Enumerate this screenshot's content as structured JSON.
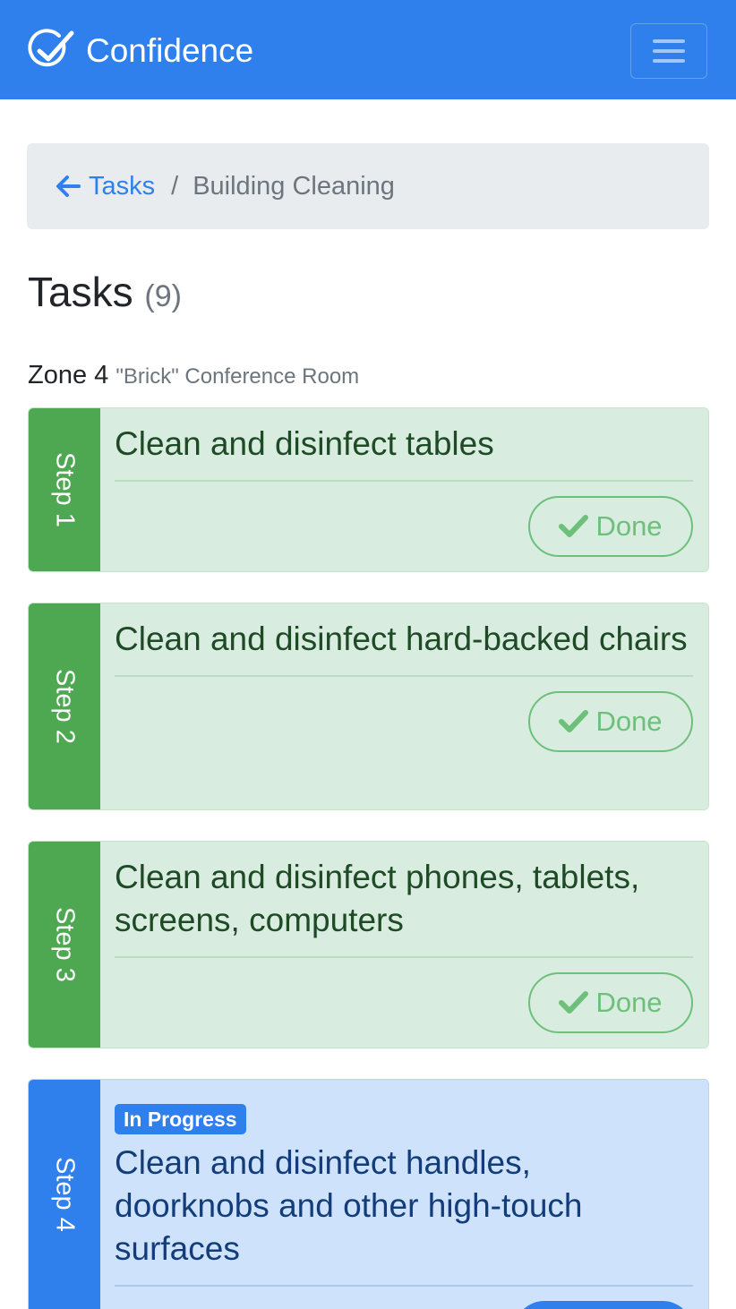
{
  "navbar": {
    "brand": "Confidence",
    "brand_icon": "check-circle-icon",
    "menu_icon": "hamburger-menu-icon",
    "color": "#2f80ed"
  },
  "breadcrumb": {
    "back_icon": "arrow-left-icon",
    "link_label": "Tasks",
    "separator": "/",
    "current": "Building Cleaning"
  },
  "page": {
    "title": "Tasks",
    "count": "(9)"
  },
  "zone": {
    "label": "Zone 4",
    "name": "\"Brick\" Conference Room"
  },
  "tasks": [
    {
      "step": "Step 1",
      "title": "Clean and disinfect tables",
      "status": "done",
      "button_label": "Done",
      "button_icon": "check-icon"
    },
    {
      "step": "Step 2",
      "title": "Clean and disinfect hard-backed chairs",
      "status": "done",
      "button_label": "Done",
      "button_icon": "check-icon"
    },
    {
      "step": "Step 3",
      "title": "Clean and disinfect phones, tablets, screens, computers",
      "status": "done",
      "button_label": "Done",
      "button_icon": "check-icon"
    },
    {
      "step": "Step 4",
      "title": "Clean and disinfect handles, doorknobs and other high-touch surfaces",
      "status": "in-progress",
      "badge": "In Progress"
    }
  ],
  "colors": {
    "done_green": "#4ea852",
    "done_bg": "#d9ece0",
    "progress_blue": "#2f80ed",
    "progress_bg": "#cfe2fc"
  }
}
